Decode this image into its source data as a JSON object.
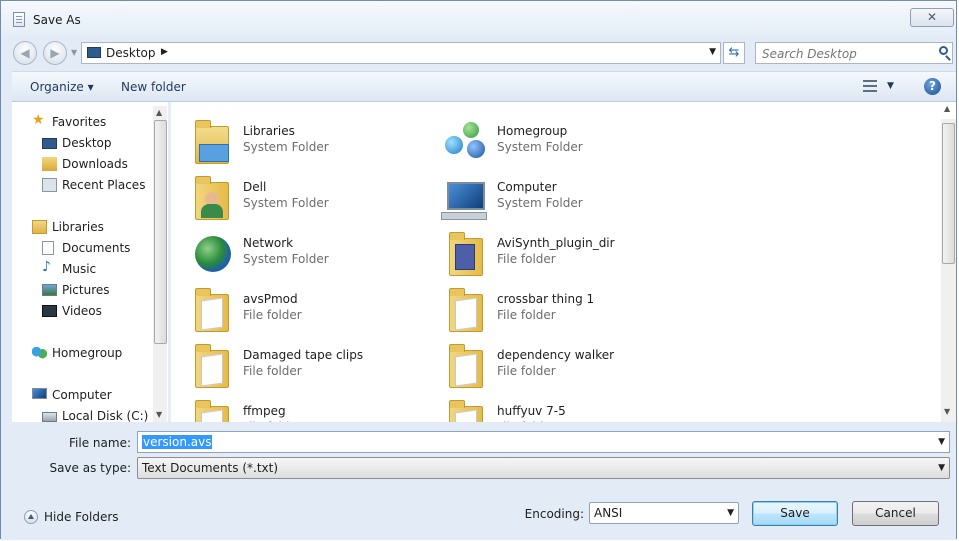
{
  "window": {
    "title": "Save As",
    "close_glyph": "✕"
  },
  "nav": {
    "back_glyph": "◀",
    "forward_glyph": "▶",
    "address_location": "Desktop",
    "address_sep": "▶",
    "search_placeholder": "Search Desktop"
  },
  "toolbar": {
    "organize_label": "Organize ▾",
    "new_folder_label": "New folder",
    "help_glyph": "?"
  },
  "sidebar": {
    "items": [
      {
        "label": "Favorites",
        "icon": "star-icon",
        "group": true
      },
      {
        "label": "Desktop",
        "icon": "desktop-icon"
      },
      {
        "label": "Downloads",
        "icon": "downloads-icon"
      },
      {
        "label": "Recent Places",
        "icon": "recent-places-icon"
      },
      {
        "label": "Libraries",
        "icon": "libraries-icon",
        "group": true
      },
      {
        "label": "Documents",
        "icon": "documents-icon"
      },
      {
        "label": "Music",
        "icon": "music-icon"
      },
      {
        "label": "Pictures",
        "icon": "pictures-icon"
      },
      {
        "label": "Videos",
        "icon": "videos-icon"
      },
      {
        "label": "Homegroup",
        "icon": "homegroup-icon",
        "group": true
      },
      {
        "label": "Computer",
        "icon": "computer-icon",
        "group": true
      },
      {
        "label": "Local Disk (C:)",
        "icon": "disk-icon"
      }
    ]
  },
  "files": [
    {
      "name": "Libraries",
      "type": "System Folder",
      "icon": "libraries-folder-icon"
    },
    {
      "name": "Homegroup",
      "type": "System Folder",
      "icon": "homegroup-icon"
    },
    {
      "name": "Dell",
      "type": "System Folder",
      "icon": "user-folder-icon"
    },
    {
      "name": "Computer",
      "type": "System Folder",
      "icon": "computer-icon"
    },
    {
      "name": "Network",
      "type": "System Folder",
      "icon": "network-icon"
    },
    {
      "name": "AviSynth_plugin_dir",
      "type": "File folder",
      "icon": "folder-icon"
    },
    {
      "name": "avsPmod",
      "type": "File folder",
      "icon": "folder-icon"
    },
    {
      "name": "crossbar thing 1",
      "type": "File folder",
      "icon": "folder-icon"
    },
    {
      "name": "Damaged tape clips",
      "type": "File folder",
      "icon": "folder-icon"
    },
    {
      "name": "dependency walker",
      "type": "File folder",
      "icon": "folder-icon"
    },
    {
      "name": "ffmpeg",
      "type": "File folder",
      "icon": "folder-icon"
    },
    {
      "name": "huffyuv 7-5",
      "type": "File folder",
      "icon": "folder-icon"
    }
  ],
  "form": {
    "file_name_label": "File name:",
    "file_name_value": "version.avs",
    "save_type_label": "Save as type:",
    "save_type_value": "Text Documents (*.txt)",
    "encoding_label": "Encoding:",
    "encoding_value": "ANSI",
    "save_label": "Save",
    "cancel_label": "Cancel",
    "hide_folders_label": "Hide Folders",
    "dropdown_glyph": "▼"
  }
}
